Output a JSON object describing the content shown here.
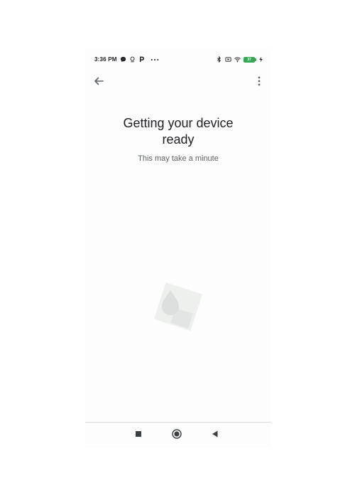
{
  "status_bar": {
    "time": "3:36 PM",
    "battery_level": "37",
    "left_icons": [
      "messenger-icon",
      "location-pin-icon",
      "p-app-icon",
      "overflow-dots-icon"
    ],
    "right_icons": [
      "bluetooth-icon",
      "screen-icon",
      "wifi-icon",
      "battery-icon",
      "charging-icon"
    ]
  },
  "app_bar": {
    "back_icon": "arrow-back-icon",
    "menu_icon": "more-vert-icon"
  },
  "content": {
    "title": "Getting your device ready",
    "subtitle": "This may take a minute",
    "illustration": "device-setup-illustration"
  },
  "nav_bar": {
    "buttons": [
      "recents-square-icon",
      "home-circle-icon",
      "back-triangle-icon"
    ]
  },
  "colors": {
    "background": "#fcfdfc",
    "text_primary": "#202124",
    "text_secondary": "#5f6368",
    "battery": "#34a853"
  }
}
